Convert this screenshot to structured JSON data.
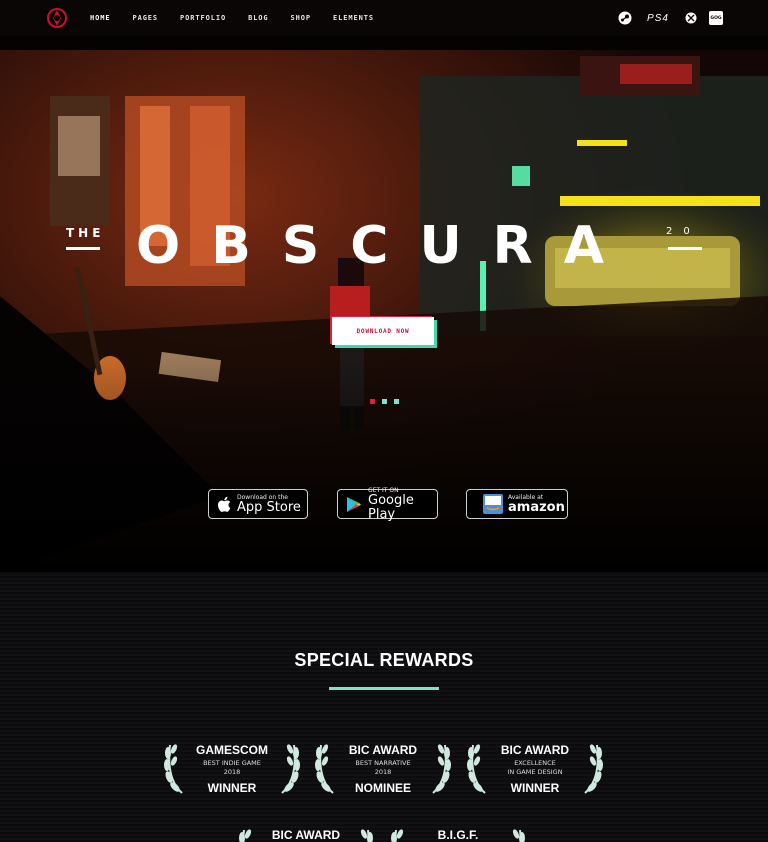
{
  "nav": {
    "items": [
      "HOME",
      "PAGES",
      "PORTFOLIO",
      "BLOG",
      "SHOP",
      "ELEMENTS"
    ],
    "active": "HOME",
    "platforms": [
      "steam-icon",
      "ps4-logo",
      "xbox-icon",
      "gog-icon"
    ],
    "ps4_label": "PS4",
    "gog_label": "GOG"
  },
  "hero": {
    "title_prefix": "THE",
    "title": "OBSCURA",
    "title_suffix": "20",
    "cta_label": "DOWNLOAD NOW",
    "slider_dots": [
      {
        "color": "#e0203a",
        "active": true
      },
      {
        "color": "#7fe3c8",
        "active": false
      },
      {
        "color": "#7fe3c8",
        "active": false
      }
    ]
  },
  "stores": [
    {
      "icon": "apple-icon",
      "small": "Download on the",
      "big": "App Store"
    },
    {
      "icon": "google-play-icon",
      "small": "GET IT ON",
      "big": "Google Play"
    },
    {
      "icon": "amazon-appstore-icon",
      "small": "Available at",
      "big": "amazon"
    }
  ],
  "rewards": {
    "title": "SPECIAL REWARDS",
    "awards": [
      {
        "name": "GAMESCOM",
        "desc": "BEST INDIE GAME\n2018",
        "result": "WINNER"
      },
      {
        "name": "BIC AWARD",
        "desc": "BEST NARRATIVE\n2018",
        "result": "NOMINEE"
      },
      {
        "name": "BIC AWARD",
        "desc": "EXCELLENCE\nIN GAME DESIGN",
        "result": "WINNER"
      },
      {
        "name": "BIC AWARD",
        "desc": "",
        "result": ""
      },
      {
        "name": "B.I.G.F.",
        "desc": "",
        "result": ""
      }
    ]
  },
  "colors": {
    "accent_red": "#e0203a",
    "accent_mint": "#7fe3c8",
    "nav_bg": "#0b0606"
  }
}
